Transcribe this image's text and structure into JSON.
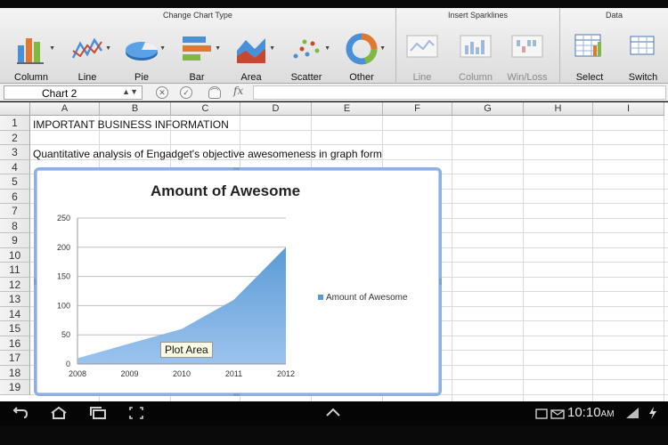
{
  "ribbon": {
    "groups": {
      "change_chart_type": "Change Chart Type",
      "insert_sparklines": "Insert Sparklines",
      "data": "Data"
    },
    "buttons": {
      "column": "Column",
      "line": "Line",
      "pie": "Pie",
      "bar": "Bar",
      "area": "Area",
      "scatter": "Scatter",
      "other": "Other",
      "spark_line": "Line",
      "spark_column": "Column",
      "spark_winloss": "Win/Loss",
      "select": "Select",
      "switch": "Switch"
    }
  },
  "formula_bar": {
    "name_box": "Chart 2",
    "fx": "fx"
  },
  "sheet": {
    "columns": [
      "A",
      "B",
      "C",
      "D",
      "E",
      "F",
      "G",
      "H",
      "I"
    ],
    "rows": [
      "1",
      "2",
      "3",
      "4",
      "5",
      "6",
      "7",
      "8",
      "9",
      "10",
      "11",
      "12",
      "13",
      "14",
      "15",
      "16",
      "17",
      "18",
      "19"
    ],
    "a1": "IMPORTANT BUSINESS INFORMATION",
    "a3": "Quantitative analysis of Engadget's objective awesomeness in graph form"
  },
  "chart_data": {
    "type": "area",
    "title": "Amount of Awesome",
    "categories": [
      "2008",
      "2009",
      "2010",
      "2011",
      "2012"
    ],
    "series": [
      {
        "name": "Amount of Awesome",
        "values": [
          10,
          35,
          60,
          110,
          200
        ]
      }
    ],
    "ylim": [
      0,
      250
    ],
    "yticks": [
      "0",
      "50",
      "100",
      "150",
      "200",
      "250"
    ],
    "xlabel": "",
    "ylabel": "",
    "grid": true,
    "legend_position": "right",
    "color": "#5b9bd5"
  },
  "chart_tooltip": "Plot Area",
  "statusbar": {
    "time": "10:10",
    "ampm": "AM"
  }
}
